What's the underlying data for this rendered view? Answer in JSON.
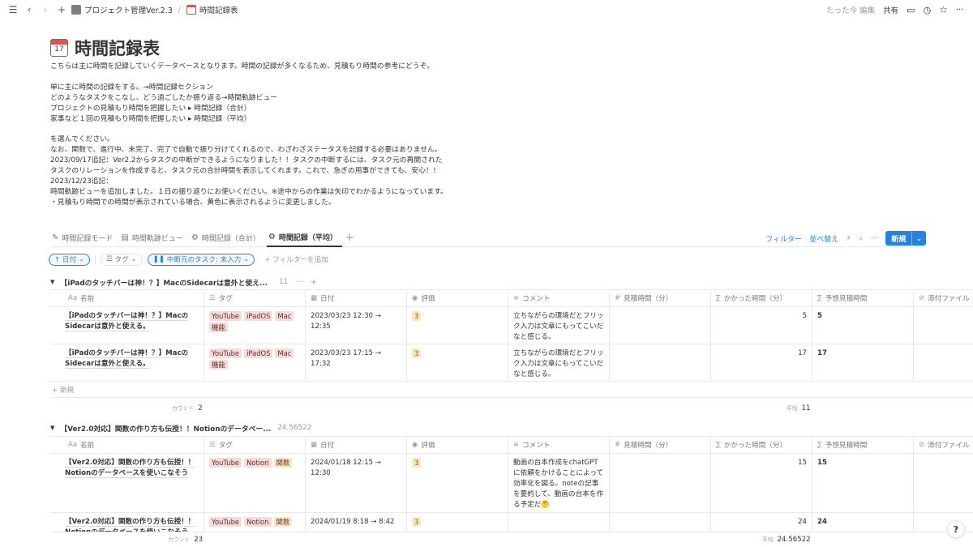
{
  "topbar": {
    "breadcrumb": [
      "プロジェクト管理Ver.2.3",
      "時間記録表"
    ],
    "edited": "たった今 編集",
    "share": "共有"
  },
  "page": {
    "icon": "calendar-icon",
    "icon_day": "17",
    "title": "時間記録表",
    "description": "こちらは主に時間を記録していくデータベースとなります。時間の記録が多くなるため、見積もり時間の参考にどうぞ。\n\n単に主に時間の記録をする。→時間記録セクション\nどのようなタスクをこなし、どう過ごしたか振り返る→時間軌跡ビュー\nプロジェクトの見積もり時間を把握したい ▸ 時間記録（合計）\n家事など１回の見積もり時間を把握したい ▸ 時間記録（平均）\n\nを選んでください。\nなお、関数で、進行中、未完了、完了で自動で振り分けてくれるので、わざわざステータスを記録する必要はありません。\n2023/09/17追記：Ver2.2からタスクの中断ができるようになりました！！タスクの中断するには、タスク元の再開されたタスクのリレーションを作成すると、タスク元の合計時間を表示してくれます。これで、急ぎの用事ができても、安心！！\n2023/12/23追記：\n時間軌跡ビューを追加しました。１日の振り返りにお使いください。※途中からの作業は矢印でわかるようになっています。\n・見積もり時間での時間が表示されている場合、黄色に表示されるように変更しました。"
  },
  "tabs": [
    {
      "label": "時間記録モード",
      "icon": "pencil-icon"
    },
    {
      "label": "時間軌跡ビュー",
      "icon": "board-icon"
    },
    {
      "label": "時間記録（合計）",
      "icon": "gear-icon"
    },
    {
      "label": "時間記録（平均）",
      "icon": "gear-icon",
      "active": true
    }
  ],
  "toolbar": {
    "filter": "フィルター",
    "sort": "並べ替え",
    "new": "新規"
  },
  "filters": {
    "date": "↑ 日付",
    "tag": "タグ",
    "interrupt": "中断元のタスク: 未入力",
    "add": "+ フィルターを追加"
  },
  "columns": [
    "名前",
    "タグ",
    "日付",
    "評価",
    "コメント",
    "見積時間（分）",
    "かかった時間（分）",
    "予想見積時間",
    "添付ファイル"
  ],
  "groups": [
    {
      "title": "【iPadのタッチバーは神！？】MacのSidecarは意外と使え...",
      "count": "11",
      "rows": [
        {
          "name": "【iPadのタッチバーは神！？】MacのSidecarは意外と使える。",
          "tags": [
            "YouTube",
            "iPadOS",
            "Mac",
            "機能"
          ],
          "date": "2023/03/23 12:30 → 12:35",
          "eval": "3",
          "comment": "立ちながらの環境だとフリック入力は文章にもってこいだなと感じる。",
          "took": "5",
          "pred": "5"
        },
        {
          "name": "【iPadのタッチバーは神！？】MacのSidecarは意外と使える。",
          "tags": [
            "YouTube",
            "iPadOS",
            "Mac",
            "機能"
          ],
          "date": "2023/03/23 17:15 → 17:32",
          "eval": "3",
          "comment": "立ちながらの環境だとフリック入力は文章にもってこいだなと感じる。",
          "took": "17",
          "pred": "17"
        }
      ],
      "new_label": "+ 新規",
      "count_label": "カウント",
      "count_value": "2",
      "avg_label": "平均",
      "avg_value": "11"
    },
    {
      "title": "【Ver2.0対応】関数の作り方も伝授！！Notionのデータベー...",
      "count": "24.56522",
      "rows": [
        {
          "name": "【Ver2.0対応】関数の作り方も伝授！！Notionのデータベースを使いこなそう",
          "tags": [
            "YouTube",
            "Notion",
            "関数"
          ],
          "date": "2024/01/18 12:15 → 12:30",
          "eval": "3",
          "comment": "動画の台本作成をchatGPTに依頼をかけることによって効率化を図る。noteの記事を要約して、動画の台本を作る予定だ🤔",
          "took": "15",
          "pred": "15"
        },
        {
          "name": "【Ver2.0対応】関数の作り方も伝授！！Notionのデータベースを使いこなそう",
          "tags": [
            "YouTube",
            "Notion",
            "関数"
          ],
          "date": "2024/01/19 8:18 → 8:42",
          "eval": "3",
          "comment": "",
          "took": "24",
          "pred": "24"
        }
      ],
      "count_label": "カウント",
      "count_value": "23",
      "avg_label": "平均",
      "avg_value": "24.56522"
    }
  ]
}
